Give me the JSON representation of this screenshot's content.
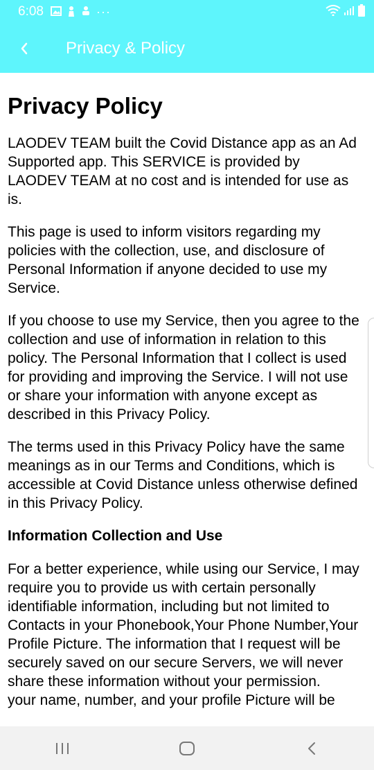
{
  "status_bar": {
    "time": "6:08",
    "left_icons": [
      "image-icon",
      "person-icon",
      "android-icon",
      "more-dots-icon"
    ],
    "right_icons": [
      "wifi-icon",
      "signal-icon",
      "battery-icon"
    ]
  },
  "app_bar": {
    "title": "Privacy & Policy",
    "background": "#5ef5fc"
  },
  "content": {
    "heading": "Privacy Policy",
    "paragraphs": [
      "LAODEV TEAM built the Covid Distance app as an Ad Supported app. This SERVICE is provided by LAODEV TEAM at no cost and is intended for use as is.",
      "This page is used to inform visitors regarding my policies with the collection, use, and disclosure of Personal Information if anyone decided to use my Service.",
      "If you choose to use my Service, then you agree to the collection and use of information in relation to this policy. The Personal Information that I collect is used for providing and improving the Service. I will not use or share your information with anyone except as described in this Privacy Policy.",
      "The terms used in this Privacy Policy have the same meanings as in our Terms and Conditions, which is accessible at Covid Distance unless otherwise defined in this Privacy Policy."
    ],
    "section_heading": "Information Collection and Use",
    "section_paragraph_lines": [
      "For a better experience, while using our Service, I may require you to provide us with certain personally identifiable information, including but not limited to Contacts in your Phonebook,Your Phone Number,Your Profile Picture. The information that I request will be securely saved on our secure Servers, we will never share these information without your permission.",
      "your name, number, and your profile Picture will be"
    ]
  },
  "nav_bar": {
    "recent_icon": "recent-apps-icon",
    "home_icon": "home-icon",
    "back_icon": "back-icon"
  }
}
